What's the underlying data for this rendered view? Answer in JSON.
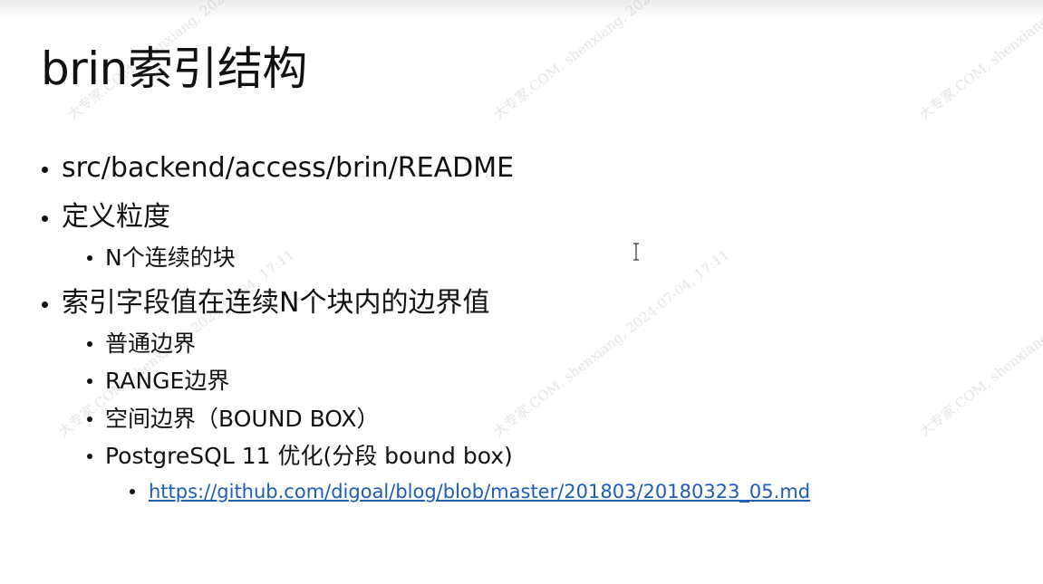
{
  "slide": {
    "title": "brin索引结构",
    "bullets": [
      {
        "level": 1,
        "text": "src/backend/access/brin/README"
      },
      {
        "level": 1,
        "text": "定义粒度"
      },
      {
        "level": 2,
        "text": "N个连续的块"
      },
      {
        "level": 1,
        "text": "索引字段值在连续N个块内的边界值"
      },
      {
        "level": 2,
        "text": "普通边界"
      },
      {
        "level": 2,
        "text": "RANGE边界"
      },
      {
        "level": 2,
        "text": "空间边界（BOUND BOX）"
      },
      {
        "level": 2,
        "text": "PostgreSQL 11 优化(分段 bound box)"
      },
      {
        "level": 3,
        "text": "https://github.com/digoal/blog/blob/master/201803/20180323_05.md",
        "link": "https://github.com/digoal/blog/blob/master/201803/20180323_05.md"
      }
    ]
  },
  "watermark": {
    "text": "大专家.COM, shenxiang, 2024-07-04, 17:11"
  },
  "colors": {
    "text": "#111111",
    "link": "#1f5cb5",
    "watermark": "#a0a0a0"
  },
  "cursor": {
    "icon": "text-cursor-icon"
  }
}
